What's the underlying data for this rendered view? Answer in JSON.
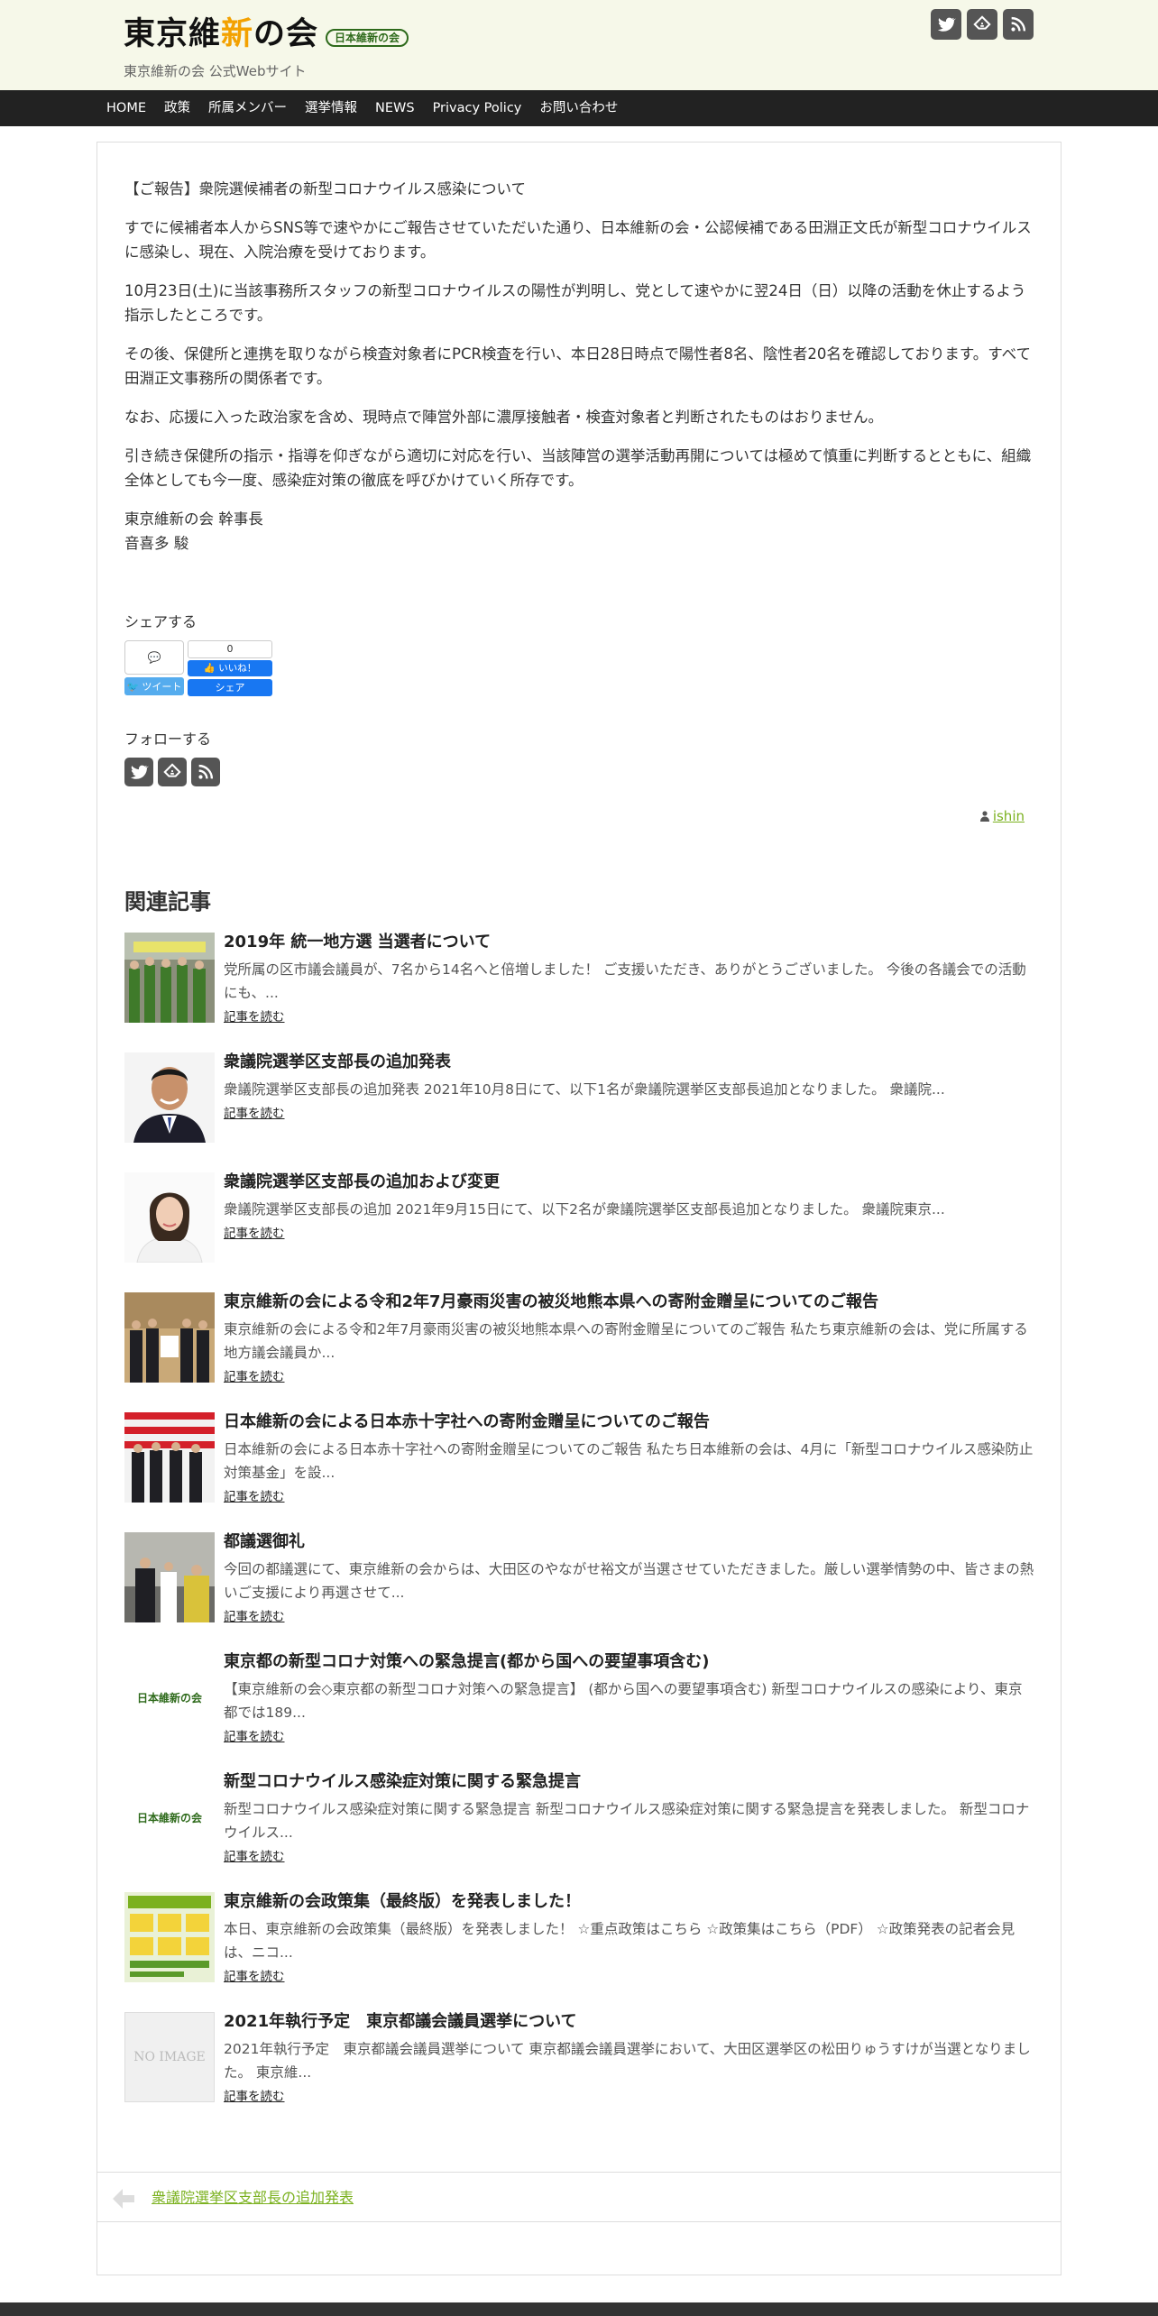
{
  "site": {
    "logo_pre": "東京維",
    "logo_accent": "新",
    "logo_post": "の会",
    "logo_badge": "日本維新の会",
    "tagline": "東京維新の会 公式Webサイト",
    "social_icons": [
      "twitter-icon",
      "feedly-icon",
      "rss-icon"
    ]
  },
  "nav": {
    "items": [
      "HOME",
      "政策",
      "所属メンバー",
      "選挙情報",
      "NEWS",
      "Privacy Policy",
      "お問い合わせ"
    ]
  },
  "post": {
    "paragraphs": [
      "【ご報告】衆院選候補者の新型コロナウイルス感染について",
      "すでに候補者本人からSNS等で速やかにご報告させていただいた通り、日本維新の会・公認候補である田淵正文氏が新型コロナウイルスに感染し、現在、入院治療を受けております。",
      "10月23日(土)に当該事務所スタッフの新型コロナウイルスの陽性が判明し、党として速やかに翌24日（日）以降の活動を休止するよう指示したところです。",
      "その後、保健所と連携を取りながら検査対象者にPCR検査を行い、本日28日時点で陽性者8名、陰性者20名を確認しております。すべて田淵正文事務所の関係者です。",
      "なお、応援に入った政治家を含め、現時点で陣営外部に濃厚接触者・検査対象者と判断されたものはおりません。",
      "引き続き保健所の指示・指導を仰ぎながら適切に対応を行い、当該陣営の選挙活動再開については極めて慎重に判断するとともに、組織全体としても今一度、感染症対策の徹底を呼びかけていく所存です。"
    ],
    "signoff_1": "東京維新の会 幹事長",
    "signoff_2": "音喜多 駿"
  },
  "share": {
    "title": "シェアする",
    "tweet": "ツイート",
    "fb_count": "0",
    "fb_like": "いいね！",
    "fb_share": "シェア"
  },
  "follow": {
    "title": "フォローする"
  },
  "author": {
    "name": "ishin"
  },
  "related": {
    "title": "関連記事",
    "more_label": "記事を読む",
    "items": [
      {
        "title": "2019年 統一地方選 当選者について",
        "excerpt": "党所属の区市議会議員が、7名から14名へと倍増しました！ ご支援いただき、ありがとうございました。 今後の各議会での活動にも、..."
      },
      {
        "title": "衆議院選挙区支部長の追加発表",
        "excerpt": "衆議院選挙区支部長の追加発表 2021年10月8日にて、以下1名が衆議院選挙区支部長追加となりました。 衆議院..."
      },
      {
        "title": "衆議院選挙区支部長の追加および変更",
        "excerpt": "衆議院選挙区支部長の追加 2021年9月15日にて、以下2名が衆議院選挙区支部長追加となりました。 衆議院東京..."
      },
      {
        "title": "東京維新の会による令和2年7月豪雨災害の被災地熊本県への寄附金贈呈についてのご報告",
        "excerpt": "東京維新の会による令和2年7月豪雨災害の被災地熊本県への寄附金贈呈についてのご報告 私たち東京維新の会は、党に所属する地方議会議員か..."
      },
      {
        "title": "日本維新の会による日本赤十字社への寄附金贈呈についてのご報告",
        "excerpt": "日本維新の会による日本赤十字社への寄附金贈呈についてのご報告 私たち日本維新の会は、4月に「新型コロナウイルス感染防止対策基金」を設..."
      },
      {
        "title": "都議選御礼",
        "excerpt": "今回の都議選にて、東京維新の会からは、大田区のやながせ裕文が当選させていただきました。厳しい選挙情勢の中、皆さまの熱いご支援により再選させて..."
      },
      {
        "title": "東京都の新型コロナ対策への緊急提言(都から国への要望事項含む)",
        "excerpt": "【東京維新の会◇東京都の新型コロナ対策への緊急提言】 (都から国への要望事項含む) 新型コロナウイルスの感染により、東京都では189..."
      },
      {
        "title": "新型コロナウイルス感染症対策に関する緊急提言",
        "excerpt": "新型コロナウイルス感染症対策に関する緊急提言 新型コロナウイルス感染症対策に関する緊急提言を発表しました。 新型コロナウイルス..."
      },
      {
        "title": "東京維新の会政策集（最終版）を発表しました！",
        "excerpt": "本日、東京維新の会政策集（最終版）を発表しました！ ☆重点政策はこちら ☆政策集はこちら（PDF） ☆政策発表の記者会見は、ニコ..."
      },
      {
        "title": "2021年執行予定　東京都議会議員選挙について",
        "excerpt": "2021年執行予定　東京都議会議員選挙について 東京都議会議員選挙において、大田区選挙区の松田りゅうすけが当選となりました。 東京維..."
      }
    ],
    "badge_text": "日本維新の会",
    "no_image": "NO IMAGE"
  },
  "post_nav": {
    "prev_label": "衆議院選挙区支部長の追加発表"
  }
}
